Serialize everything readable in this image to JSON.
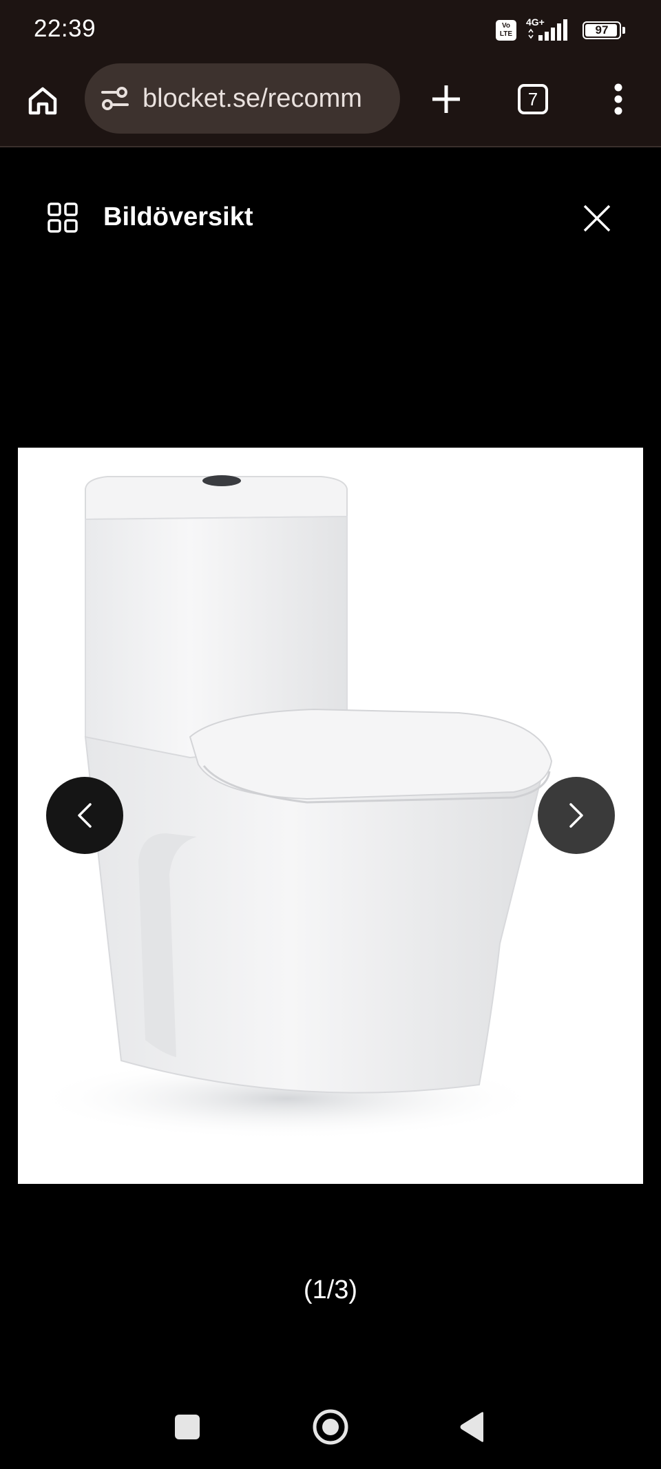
{
  "status_bar": {
    "time": "22:39",
    "volte_top": "Vo",
    "volte_bottom": "LTE",
    "network": "4G+",
    "battery": "97",
    "battery_level": 0.97
  },
  "browser": {
    "url": "blocket.se/recomm",
    "tab_count": "7",
    "icons": {
      "home": "home-icon",
      "site_settings": "tune-icon",
      "new_tab": "plus-icon",
      "menu": "more-vert-icon"
    }
  },
  "gallery": {
    "title": "Bildöversikt",
    "counter": "(1/3)",
    "image_alt": "toilet product photo"
  },
  "colors": {
    "chrome": "#1d1412",
    "url_pill": "#3d322e",
    "background": "#000000",
    "prev_arrow_bg": "#151515",
    "next_arrow_bg": "#3a3a3a"
  }
}
